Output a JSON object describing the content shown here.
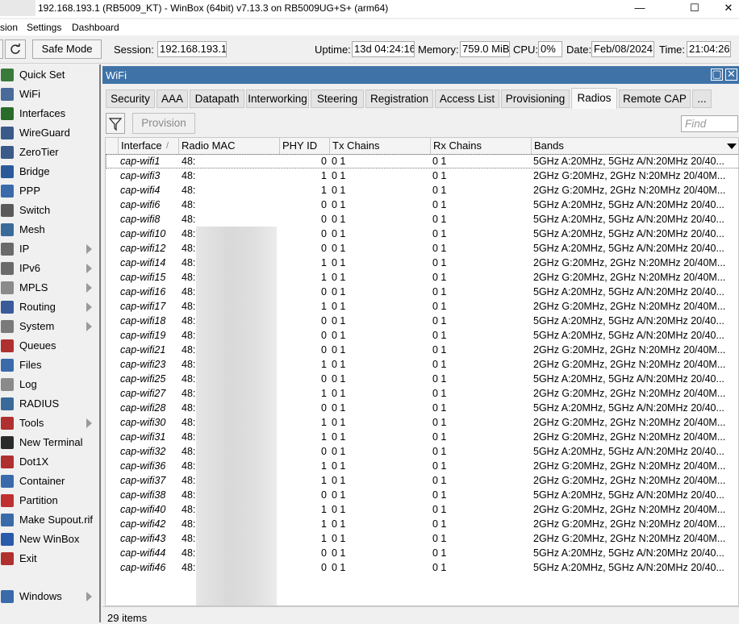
{
  "window": {
    "title": "192.168.193.1 (RB5009_KT) - WinBox (64bit) v7.13.3 on RB5009UG+S+ (arm64)",
    "minimize": "—",
    "maximize": "☐",
    "close": "✕"
  },
  "menu": [
    "sion",
    "Settings",
    "Dashboard"
  ],
  "toolbar": {
    "safe_mode": "Safe Mode",
    "session_label": "Session:",
    "session_value": "192.168.193.1",
    "uptime_label": "Uptime:",
    "uptime_value": "13d 04:24:16",
    "memory_label": "Memory:",
    "memory_value": "759.0 MiB",
    "cpu_label": "CPU:",
    "cpu_value": "0%",
    "date_label": "Date:",
    "date_value": "Feb/08/2024",
    "time_label": "Time:",
    "time_value": "21:04:26"
  },
  "sidebar": {
    "items": [
      {
        "label": "Quick Set",
        "icon": "quick-set-icon",
        "color": "#3a7a3a",
        "arrow": false
      },
      {
        "label": "WiFi",
        "icon": "wifi-icon",
        "color": "#4a6a9a",
        "arrow": false
      },
      {
        "label": "Interfaces",
        "icon": "interfaces-icon",
        "color": "#2a6a2a",
        "arrow": false
      },
      {
        "label": "WireGuard",
        "icon": "wireguard-icon",
        "color": "#3a5a8a",
        "arrow": false
      },
      {
        "label": "ZeroTier",
        "icon": "zerotier-icon",
        "color": "#3a5a8a",
        "arrow": false
      },
      {
        "label": "Bridge",
        "icon": "bridge-icon",
        "color": "#2a5a9a",
        "arrow": false
      },
      {
        "label": "PPP",
        "icon": "ppp-icon",
        "color": "#3a6aaa",
        "arrow": false
      },
      {
        "label": "Switch",
        "icon": "switch-icon",
        "color": "#5a5a5a",
        "arrow": false
      },
      {
        "label": "Mesh",
        "icon": "mesh-icon",
        "color": "#3a6a9a",
        "arrow": false
      },
      {
        "label": "IP",
        "icon": "ip-icon",
        "color": "#6a6a6a",
        "arrow": true
      },
      {
        "label": "IPv6",
        "icon": "ipv6-icon",
        "color": "#6a6a6a",
        "arrow": true
      },
      {
        "label": "MPLS",
        "icon": "mpls-icon",
        "color": "#8a8a8a",
        "arrow": true
      },
      {
        "label": "Routing",
        "icon": "routing-icon",
        "color": "#3a5a9a",
        "arrow": true
      },
      {
        "label": "System",
        "icon": "system-icon",
        "color": "#7a7a7a",
        "arrow": true
      },
      {
        "label": "Queues",
        "icon": "queues-icon",
        "color": "#b03030",
        "arrow": false
      },
      {
        "label": "Files",
        "icon": "files-icon",
        "color": "#3a6aaa",
        "arrow": false
      },
      {
        "label": "Log",
        "icon": "log-icon",
        "color": "#8a8a8a",
        "arrow": false
      },
      {
        "label": "RADIUS",
        "icon": "radius-icon",
        "color": "#3a6a9a",
        "arrow": false
      },
      {
        "label": "Tools",
        "icon": "tools-icon",
        "color": "#b03030",
        "arrow": true
      },
      {
        "label": "New Terminal",
        "icon": "terminal-icon",
        "color": "#2a2a2a",
        "arrow": false
      },
      {
        "label": "Dot1X",
        "icon": "dot1x-icon",
        "color": "#b03030",
        "arrow": false
      },
      {
        "label": "Container",
        "icon": "container-icon",
        "color": "#3a6aaa",
        "arrow": false
      },
      {
        "label": "Partition",
        "icon": "partition-icon",
        "color": "#c03030",
        "arrow": false
      },
      {
        "label": "Make Supout.rif",
        "icon": "supout-icon",
        "color": "#3a6aaa",
        "arrow": false
      },
      {
        "label": "New WinBox",
        "icon": "winbox-icon",
        "color": "#2a5aaa",
        "arrow": false
      },
      {
        "label": "Exit",
        "icon": "exit-icon",
        "color": "#b03030",
        "arrow": false
      },
      {
        "label": "Windows",
        "icon": "windows-icon",
        "color": "#3a6aaa",
        "arrow": true
      }
    ]
  },
  "wifi": {
    "title": "WiFi",
    "tabs": [
      "Security",
      "AAA",
      "Datapath",
      "Interworking",
      "Steering",
      "Registration",
      "Access List",
      "Provisioning",
      "Radios",
      "Remote CAP",
      "..."
    ],
    "active_tab": "Radios",
    "provision": "Provision",
    "find_placeholder": "Find",
    "columns": [
      "Interface",
      "Radio MAC",
      "PHY ID",
      "Tx Chains",
      "Rx Chains",
      "Bands"
    ],
    "rows": [
      {
        "iface": "cap-wifi1",
        "mac": "48:",
        "phy": "0",
        "tx": "0 1",
        "rx": "0 1",
        "bands": "5GHz A:20MHz, 5GHz A/N:20MHz 20/40..."
      },
      {
        "iface": "cap-wifi3",
        "mac": "48:",
        "phy": "1",
        "tx": "0 1",
        "rx": "0 1",
        "bands": "2GHz G:20MHz, 2GHz N:20MHz 20/40M..."
      },
      {
        "iface": "cap-wifi4",
        "mac": "48:",
        "phy": "1",
        "tx": "0 1",
        "rx": "0 1",
        "bands": "2GHz G:20MHz, 2GHz N:20MHz 20/40M..."
      },
      {
        "iface": "cap-wifi6",
        "mac": "48:",
        "phy": "0",
        "tx": "0 1",
        "rx": "0 1",
        "bands": "5GHz A:20MHz, 5GHz A/N:20MHz 20/40..."
      },
      {
        "iface": "cap-wifi8",
        "mac": "48:",
        "phy": "0",
        "tx": "0 1",
        "rx": "0 1",
        "bands": "5GHz A:20MHz, 5GHz A/N:20MHz 20/40..."
      },
      {
        "iface": "cap-wifi10",
        "mac": "48:",
        "phy": "0",
        "tx": "0 1",
        "rx": "0 1",
        "bands": "5GHz A:20MHz, 5GHz A/N:20MHz 20/40..."
      },
      {
        "iface": "cap-wifi12",
        "mac": "48:",
        "phy": "0",
        "tx": "0 1",
        "rx": "0 1",
        "bands": "5GHz A:20MHz, 5GHz A/N:20MHz 20/40..."
      },
      {
        "iface": "cap-wifi14",
        "mac": "48:",
        "phy": "1",
        "tx": "0 1",
        "rx": "0 1",
        "bands": "2GHz G:20MHz, 2GHz N:20MHz 20/40M..."
      },
      {
        "iface": "cap-wifi15",
        "mac": "48:",
        "phy": "1",
        "tx": "0 1",
        "rx": "0 1",
        "bands": "2GHz G:20MHz, 2GHz N:20MHz 20/40M..."
      },
      {
        "iface": "cap-wifi16",
        "mac": "48:",
        "phy": "0",
        "tx": "0 1",
        "rx": "0 1",
        "bands": "5GHz A:20MHz, 5GHz A/N:20MHz 20/40..."
      },
      {
        "iface": "cap-wifi17",
        "mac": "48:",
        "phy": "1",
        "tx": "0 1",
        "rx": "0 1",
        "bands": "2GHz G:20MHz, 2GHz N:20MHz 20/40M..."
      },
      {
        "iface": "cap-wifi18",
        "mac": "48:",
        "phy": "0",
        "tx": "0 1",
        "rx": "0 1",
        "bands": "5GHz A:20MHz, 5GHz A/N:20MHz 20/40..."
      },
      {
        "iface": "cap-wifi19",
        "mac": "48:",
        "phy": "0",
        "tx": "0 1",
        "rx": "0 1",
        "bands": "5GHz A:20MHz, 5GHz A/N:20MHz 20/40..."
      },
      {
        "iface": "cap-wifi21",
        "mac": "48:",
        "phy": "0",
        "tx": "0 1",
        "rx": "0 1",
        "bands": "2GHz G:20MHz, 2GHz N:20MHz 20/40M..."
      },
      {
        "iface": "cap-wifi23",
        "mac": "48:",
        "phy": "1",
        "tx": "0 1",
        "rx": "0 1",
        "bands": "2GHz G:20MHz, 2GHz N:20MHz 20/40M..."
      },
      {
        "iface": "cap-wifi25",
        "mac": "48:",
        "phy": "0",
        "tx": "0 1",
        "rx": "0 1",
        "bands": "5GHz A:20MHz, 5GHz A/N:20MHz 20/40..."
      },
      {
        "iface": "cap-wifi27",
        "mac": "48:",
        "phy": "1",
        "tx": "0 1",
        "rx": "0 1",
        "bands": "2GHz G:20MHz, 2GHz N:20MHz 20/40M..."
      },
      {
        "iface": "cap-wifi28",
        "mac": "48:",
        "phy": "0",
        "tx": "0 1",
        "rx": "0 1",
        "bands": "5GHz A:20MHz, 5GHz A/N:20MHz 20/40..."
      },
      {
        "iface": "cap-wifi30",
        "mac": "48:",
        "phy": "1",
        "tx": "0 1",
        "rx": "0 1",
        "bands": "2GHz G:20MHz, 2GHz N:20MHz 20/40M..."
      },
      {
        "iface": "cap-wifi31",
        "mac": "48:",
        "phy": "1",
        "tx": "0 1",
        "rx": "0 1",
        "bands": "2GHz G:20MHz, 2GHz N:20MHz 20/40M..."
      },
      {
        "iface": "cap-wifi32",
        "mac": "48:",
        "phy": "0",
        "tx": "0 1",
        "rx": "0 1",
        "bands": "5GHz A:20MHz, 5GHz A/N:20MHz 20/40..."
      },
      {
        "iface": "cap-wifi36",
        "mac": "48:",
        "phy": "1",
        "tx": "0 1",
        "rx": "0 1",
        "bands": "2GHz G:20MHz, 2GHz N:20MHz 20/40M..."
      },
      {
        "iface": "cap-wifi37",
        "mac": "48:",
        "phy": "1",
        "tx": "0 1",
        "rx": "0 1",
        "bands": "2GHz G:20MHz, 2GHz N:20MHz 20/40M..."
      },
      {
        "iface": "cap-wifi38",
        "mac": "48:",
        "phy": "0",
        "tx": "0 1",
        "rx": "0 1",
        "bands": "5GHz A:20MHz, 5GHz A/N:20MHz 20/40..."
      },
      {
        "iface": "cap-wifi40",
        "mac": "48:",
        "phy": "1",
        "tx": "0 1",
        "rx": "0 1",
        "bands": "2GHz G:20MHz, 2GHz N:20MHz 20/40M..."
      },
      {
        "iface": "cap-wifi42",
        "mac": "48:",
        "phy": "1",
        "tx": "0 1",
        "rx": "0 1",
        "bands": "2GHz G:20MHz, 2GHz N:20MHz 20/40M..."
      },
      {
        "iface": "cap-wifi43",
        "mac": "48:",
        "phy": "1",
        "tx": "0 1",
        "rx": "0 1",
        "bands": "2GHz G:20MHz, 2GHz N:20MHz 20/40M..."
      },
      {
        "iface": "cap-wifi44",
        "mac": "48:",
        "phy": "0",
        "tx": "0 1",
        "rx": "0 1",
        "bands": "5GHz A:20MHz, 5GHz A/N:20MHz 20/40..."
      },
      {
        "iface": "cap-wifi46",
        "mac": "48:",
        "phy": "0",
        "tx": "0 1",
        "rx": "0 1",
        "bands": "5GHz A:20MHz, 5GHz A/N:20MHz 20/40..."
      }
    ],
    "status": "29 items"
  }
}
